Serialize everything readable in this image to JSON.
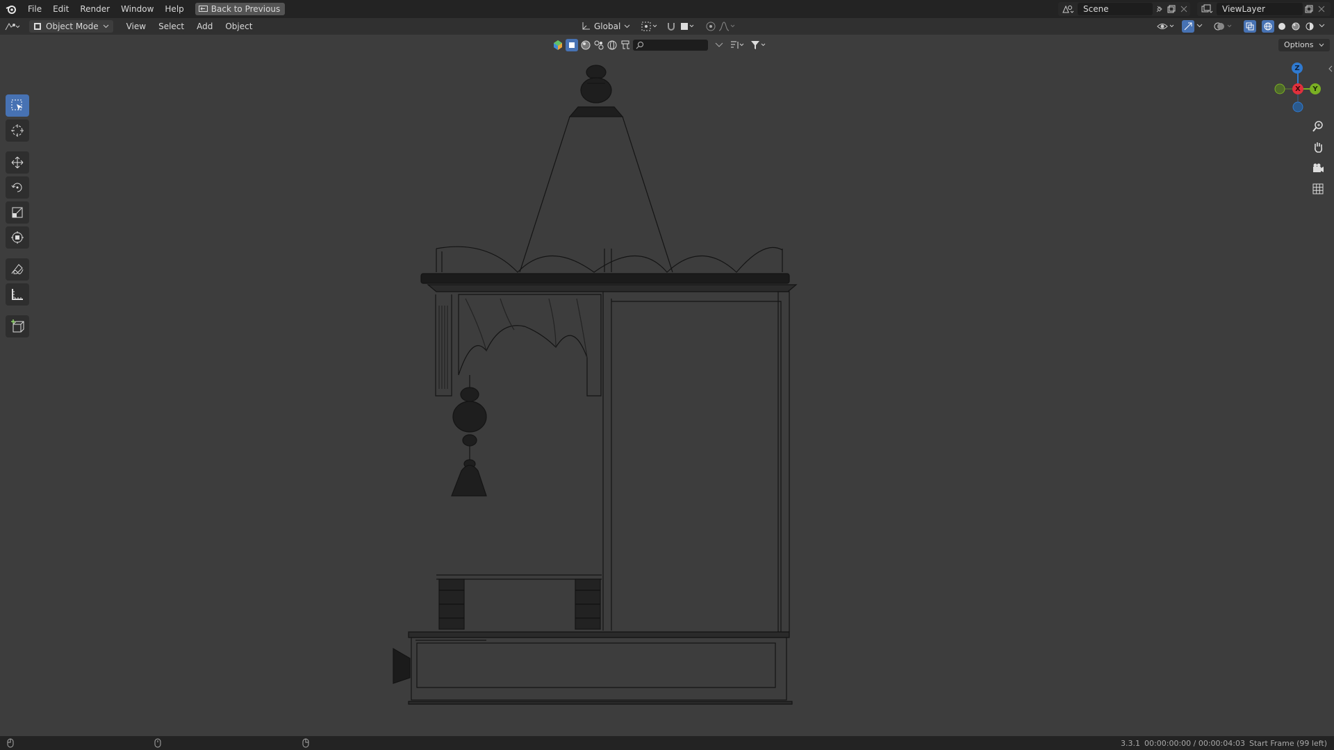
{
  "menu": {
    "file": "File",
    "edit": "Edit",
    "render": "Render",
    "window": "Window",
    "help": "Help",
    "back_button": "Back to Previous"
  },
  "scene": {
    "name": "Scene"
  },
  "view_layer": {
    "name": "ViewLayer"
  },
  "header": {
    "mode": "Object Mode",
    "view": "View",
    "select": "Select",
    "add": "Add",
    "object": "Object",
    "transform_orientation": "Global",
    "options": "Options"
  },
  "gizmo": {
    "z": "Z",
    "y": "Y",
    "x": "X"
  },
  "status": {
    "version": "3.3.1",
    "time": "00:00:00:00 / 00:00:04:03",
    "frame_info": "Start Frame (99 left)"
  },
  "colors": {
    "accent": "#4772b3",
    "axis_x": "#e0303c",
    "axis_y": "#7ab023",
    "axis_z": "#2f7ad1"
  }
}
